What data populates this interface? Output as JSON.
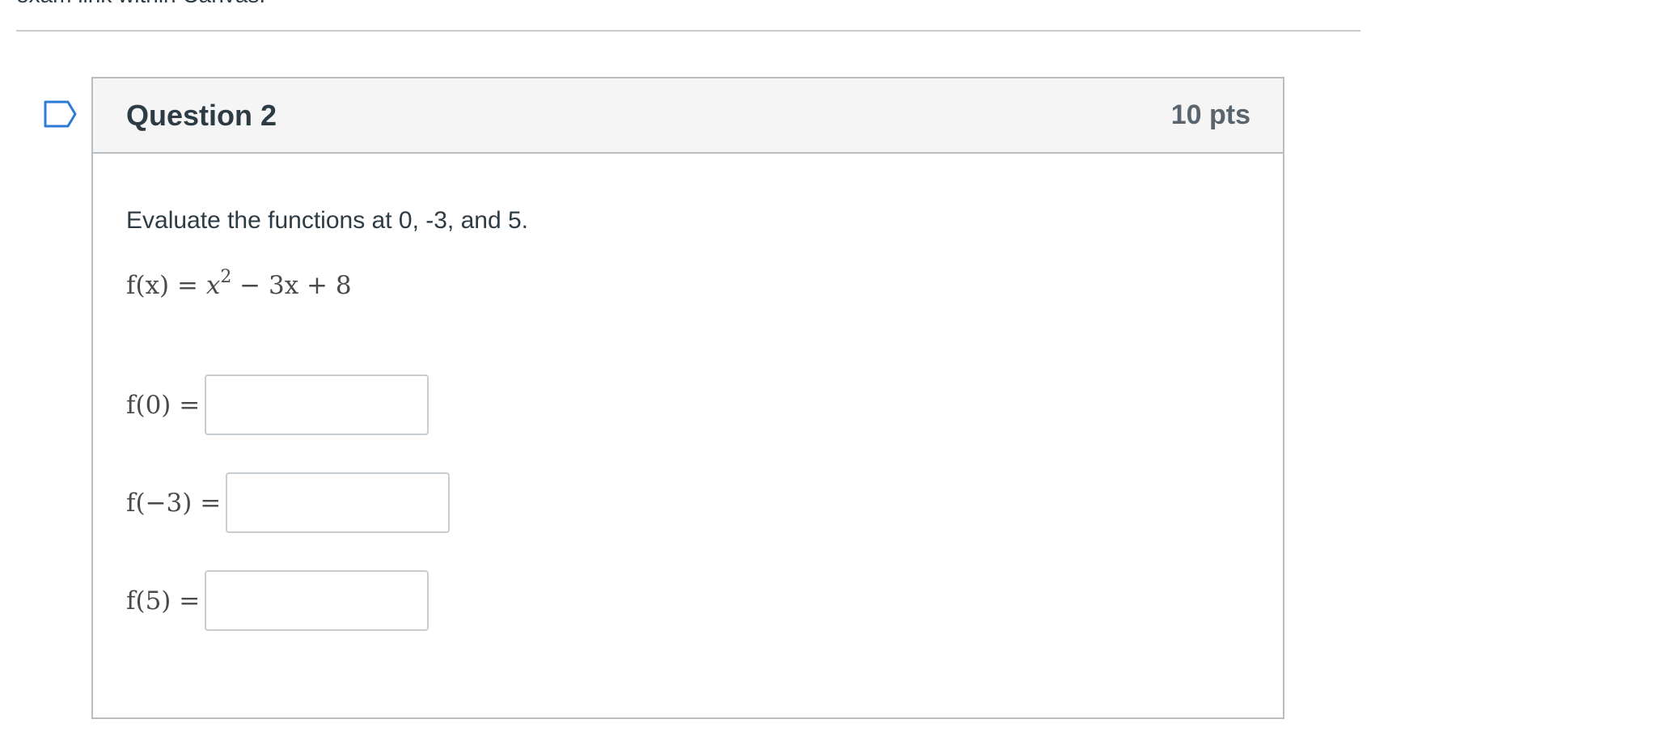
{
  "header_fragment": "exam link within Canvas.",
  "question": {
    "title": "Question 2",
    "points": "10 pts",
    "instructions": "Evaluate the functions at 0, -3, and 5.",
    "function": {
      "lhs": "f(x) = ",
      "var": "x",
      "exponent": "2",
      "rest": " − 3x + 8"
    },
    "answers": [
      {
        "label": "f(0) =",
        "value": ""
      },
      {
        "label": "f(−3) =",
        "value": ""
      },
      {
        "label": "f(5) =",
        "value": ""
      }
    ]
  },
  "colors": {
    "border": "#b8bdc1",
    "header_bg": "#f5f5f5",
    "flag_outline": "#2d7bd6",
    "text": "#2d3b45"
  },
  "icons": {
    "flag": "flag-question-icon"
  }
}
